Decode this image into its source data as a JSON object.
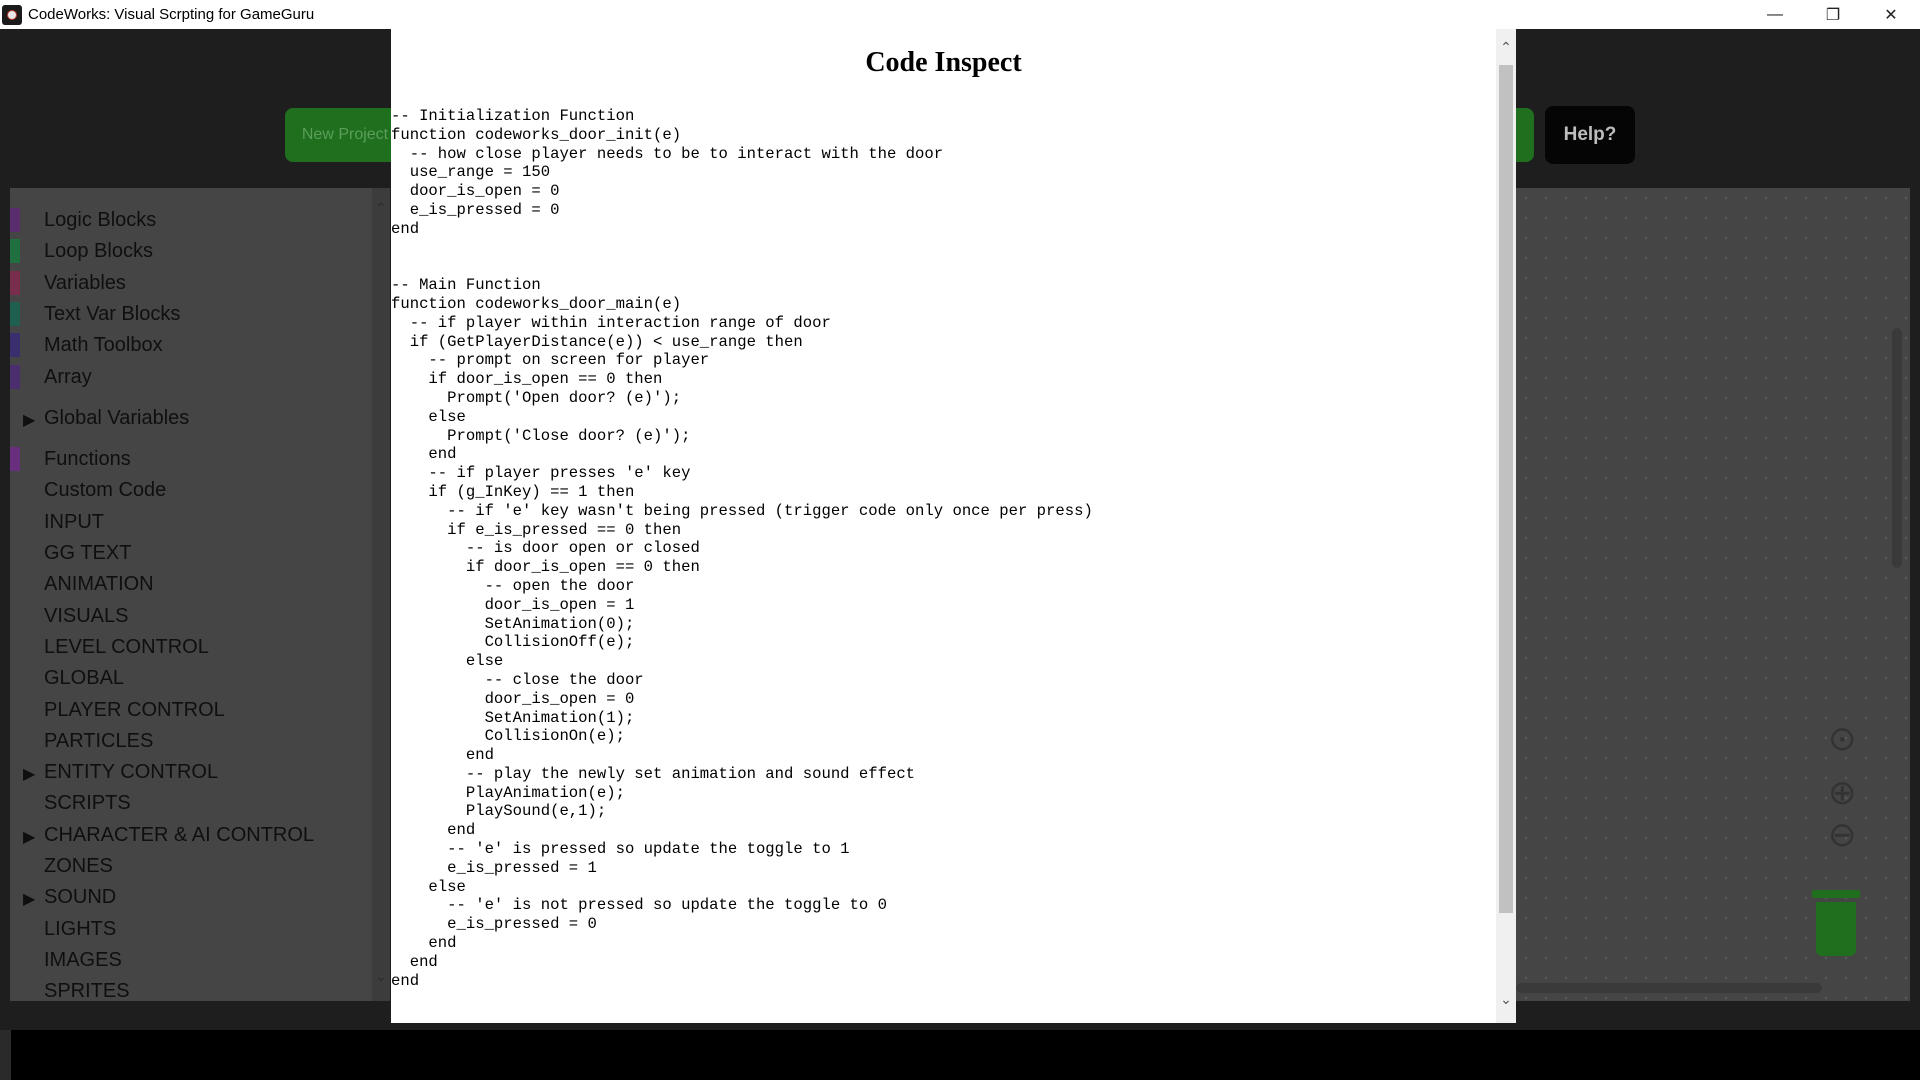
{
  "window": {
    "title": "CodeWorks: Visual Scrpting for GameGuru",
    "minimize": "—",
    "maximize": "❐",
    "close": "✕"
  },
  "toolbar": {
    "new_project": "New Project",
    "help": "Help?"
  },
  "sidebar": {
    "scroll_up": "⌃",
    "scroll_down": "⌄",
    "items": [
      {
        "label": "Logic Blocks",
        "color": "#5a2e6e"
      },
      {
        "label": "Loop Blocks",
        "color": "#1f6f3f"
      },
      {
        "label": "Variables",
        "color": "#7a2e4e"
      },
      {
        "label": "Text Var Blocks",
        "color": "#1f5f4f"
      },
      {
        "label": "Math Toolbox",
        "color": "#3a2e6e"
      },
      {
        "label": "Array",
        "color": "#4a2e6e"
      },
      {
        "label": "Global Variables",
        "expander": "▶"
      },
      {
        "label": "Functions",
        "color": "#6a2e7e"
      },
      {
        "label": "Custom Code"
      },
      {
        "label": "INPUT"
      },
      {
        "label": "GG TEXT"
      },
      {
        "label": "ANIMATION"
      },
      {
        "label": "VISUALS"
      },
      {
        "label": "LEVEL CONTROL"
      },
      {
        "label": "GLOBAL"
      },
      {
        "label": "PLAYER CONTROL"
      },
      {
        "label": "PARTICLES"
      },
      {
        "label": "ENTITY CONTROL",
        "expander": "▶"
      },
      {
        "label": "SCRIPTS"
      },
      {
        "label": "CHARACTER & AI CONTROL",
        "expander": "▶"
      },
      {
        "label": "ZONES"
      },
      {
        "label": "SOUND",
        "expander": "▶"
      },
      {
        "label": "LIGHTS"
      },
      {
        "label": "IMAGES"
      },
      {
        "label": "SPRITES"
      }
    ]
  },
  "canvas_controls": {
    "center": "⊙",
    "zoom_in": "⊕",
    "zoom_out": "⊖"
  },
  "modal": {
    "title": "Code Inspect",
    "scroll_up": "⌃",
    "scroll_down": "⌄",
    "code": "-- Initialization Function\nfunction codeworks_door_init(e)\n  -- how close player needs to be to interact with the door\n  use_range = 150\n  door_is_open = 0\n  e_is_pressed = 0\nend\n\n\n-- Main Function\nfunction codeworks_door_main(e)\n  -- if player within interaction range of door\n  if (GetPlayerDistance(e)) < use_range then\n    -- prompt on screen for player\n    if door_is_open == 0 then\n      Prompt('Open door? (e)');\n    else\n      Prompt('Close door? (e)');\n    end\n    -- if player presses 'e' key\n    if (g_InKey) == 1 then\n      -- if 'e' key wasn't being pressed (trigger code only once per press)\n      if e_is_pressed == 0 then\n        -- is door open or closed\n        if door_is_open == 0 then\n          -- open the door\n          door_is_open = 1\n          SetAnimation(0);\n          CollisionOff(e);\n        else\n          -- close the door\n          door_is_open = 0\n          SetAnimation(1);\n          CollisionOn(e);\n        end\n        -- play the newly set animation and sound effect\n        PlayAnimation(e);\n        PlaySound(e,1);\n      end\n      -- 'e' is pressed so update the toggle to 1\n      e_is_pressed = 1\n    else\n      -- 'e' is not pressed so update the toggle to 0\n      e_is_pressed = 0\n    end\n  end\nend"
  }
}
